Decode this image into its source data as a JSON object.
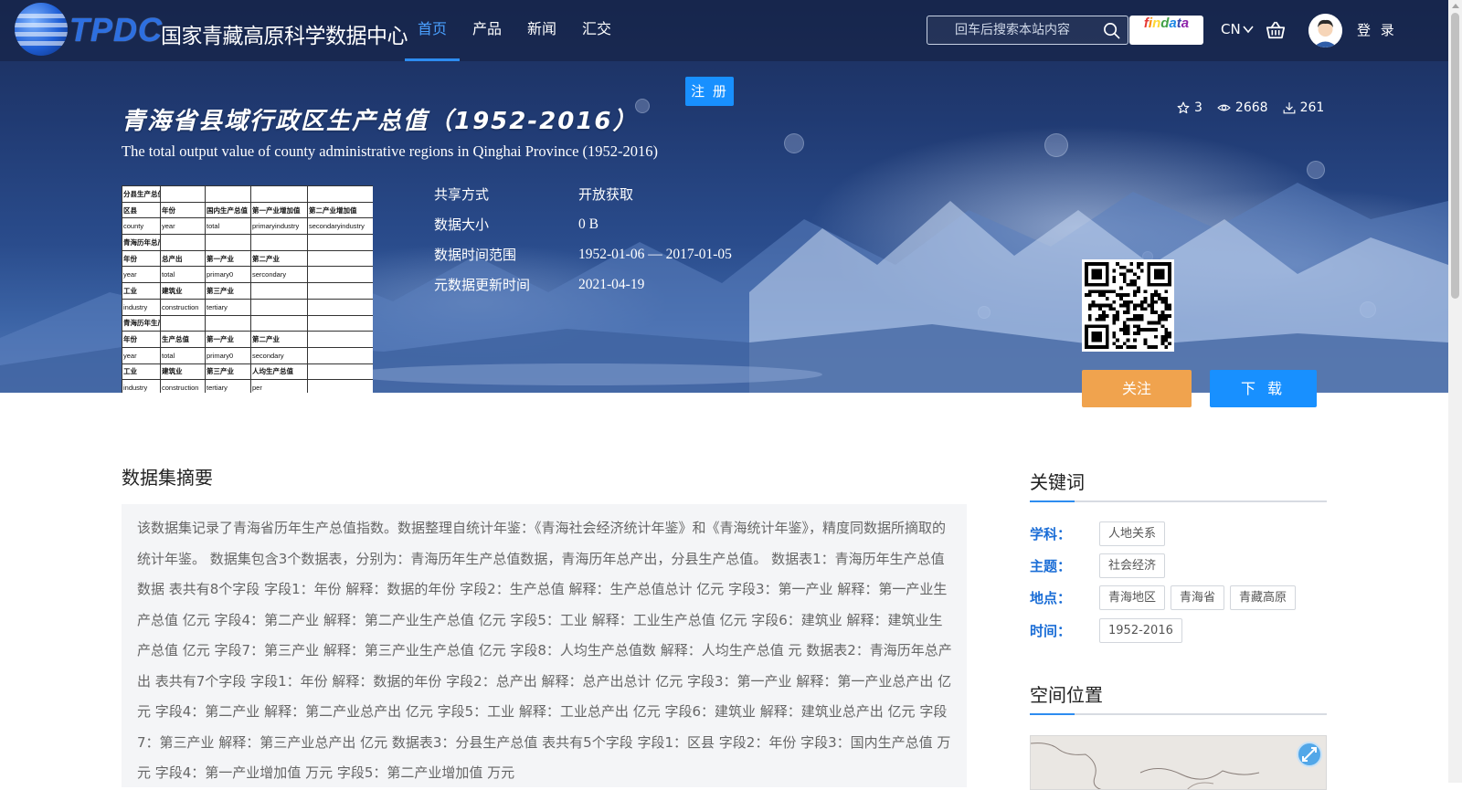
{
  "site": {
    "logo_abbr": "TPDC",
    "logo_name": "国家青藏高原科学数据中心"
  },
  "nav": {
    "items": [
      {
        "label": "首页",
        "active": true
      },
      {
        "label": "产品",
        "active": false
      },
      {
        "label": "新闻",
        "active": false
      },
      {
        "label": "汇交",
        "active": false
      }
    ]
  },
  "search": {
    "placeholder": "回车后搜索本站内容",
    "value": ""
  },
  "findata_label": "findata",
  "lang": "CN",
  "login_label": "登 录",
  "register_label": "注 册",
  "dataset": {
    "title_cn": "青海省县域行政区生产总值（1952-2016）",
    "title_en": "The total output value of county administrative regions in Qinghai Province (1952-2016)",
    "stats": {
      "stars": "3",
      "views": "2668",
      "downloads": "261"
    },
    "meta": [
      {
        "label": "共享方式",
        "value": "开放获取"
      },
      {
        "label": "数据大小",
        "value": "0 B"
      },
      {
        "label": "数据时间范围",
        "value": "1952-01-06 — 2017-01-05"
      },
      {
        "label": "元数据更新时间",
        "value": "2021-04-19"
      }
    ],
    "follow_label": "关注",
    "download_label": "下 载"
  },
  "preview_rows": [
    {
      "type": "sheet",
      "cells": [
        "分县生产总值.xls",
        "",
        "",
        "",
        ""
      ]
    },
    {
      "type": "hdr",
      "cells": [
        "区县",
        "年份",
        "国内生产总值",
        "第一产业增加值",
        "第二产业增加值"
      ]
    },
    {
      "type": "row",
      "cells": [
        "county",
        "year",
        "total",
        "primaryindustry",
        "secondaryindustry"
      ]
    },
    {
      "type": "sheet",
      "cells": [
        "青海历年总产出.xls",
        "",
        "",
        "",
        ""
      ]
    },
    {
      "type": "hdr",
      "cells": [
        "年份",
        "总产出",
        "第一产业",
        "第二产业",
        ""
      ]
    },
    {
      "type": "row",
      "cells": [
        "year",
        "total",
        "primary0",
        "sercondary",
        ""
      ]
    },
    {
      "type": "hdr",
      "cells": [
        "工业",
        "建筑业",
        "第三产业",
        "",
        ""
      ]
    },
    {
      "type": "row",
      "cells": [
        "industry",
        "construction",
        "tertiary",
        "",
        ""
      ]
    },
    {
      "type": "sheet",
      "cells": [
        "青海历年生产总值数据.xls",
        "",
        "",
        "",
        ""
      ]
    },
    {
      "type": "hdr",
      "cells": [
        "年份",
        "生产总值",
        "第一产业",
        "第二产业",
        ""
      ]
    },
    {
      "type": "row",
      "cells": [
        "year",
        "total",
        "primary0",
        "secondary",
        ""
      ]
    },
    {
      "type": "hdr",
      "cells": [
        "工业",
        "建筑业",
        "第三产业",
        "人均生产总值",
        ""
      ]
    },
    {
      "type": "row",
      "cells": [
        "industry",
        "construction",
        "tertiary",
        "per",
        ""
      ]
    }
  ],
  "abstract": {
    "title": "数据集摘要",
    "text": "该数据集记录了青海省历年生产总值指数。数据整理自统计年鉴：《青海社会经济统计年鉴》和《青海统计年鉴》，精度同数据所摘取的统计年鉴。 数据集包含3个数据表，分别为：青海历年生产总值数据，青海历年总产出，分县生产总值。 数据表1：青海历年生产总值数据 表共有8个字段 字段1：年份 解释：数据的年份 字段2：生产总值 解释：生产总值总计 亿元 字段3：第一产业 解释：第一产业生产总值 亿元 字段4：第二产业 解释：第二产业生产总值 亿元 字段5：工业 解释：工业生产总值 亿元 字段6：建筑业 解释：建筑业生产总值 亿元 字段7：第三产业 解释：第三产业生产总值 亿元 字段8：人均生产总值数 解释：人均生产总值 元 数据表2：青海历年总产出 表共有7个字段 字段1：年份 解释：数据的年份 字段2：总产出 解释：总产出总计 亿元 字段3：第一产业 解释：第一产业总产出 亿元 字段4：第二产业 解释：第二产业总产出 亿元 字段5：工业 解释：工业总产出 亿元 字段6：建筑业 解释：建筑业总产出 亿元 字段7：第三产业 解释：第三产业总产出 亿元 数据表3：分县生产总值 表共有5个字段 字段1：区县 字段2：年份 字段3：国内生产总值 万元 字段4：第一产业增加值 万元 字段5：第二产业增加值 万元"
  },
  "keywords": {
    "title": "关键词",
    "rows": [
      {
        "label": "学科：",
        "tags": [
          "人地关系"
        ]
      },
      {
        "label": "主题：",
        "tags": [
          "社会经济"
        ]
      },
      {
        "label": "地点：",
        "tags": [
          "青海地区",
          "青海省",
          "青藏高原"
        ]
      },
      {
        "label": "时间：",
        "tags": [
          "1952-2016"
        ]
      }
    ]
  },
  "location": {
    "title": "空间位置"
  },
  "colors": {
    "accent": "#1890ff",
    "follow": "#f0a34e",
    "keyword_label": "#1a6dd6",
    "nav_active": "#4aa0ff"
  }
}
